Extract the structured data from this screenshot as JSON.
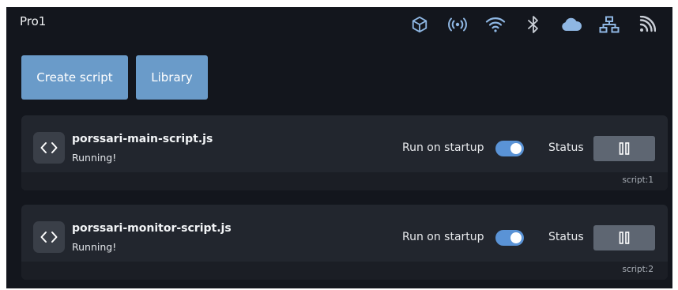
{
  "header": {
    "title": "Pro1",
    "icons": [
      "cube-icon",
      "broadcast-icon",
      "wifi-icon",
      "bluetooth-icon",
      "cloud-icon",
      "network-icon",
      "rss-icon"
    ]
  },
  "actions": {
    "create_label": "Create script",
    "library_label": "Library"
  },
  "scripts": [
    {
      "name": "porssari-main-script.js",
      "status": "Running!",
      "run_on_startup_label": "Run on startup",
      "run_on_startup": true,
      "status_label": "Status",
      "id": "script:1"
    },
    {
      "name": "porssari-monitor-script.js",
      "status": "Running!",
      "run_on_startup_label": "Run on startup",
      "run_on_startup": true,
      "status_label": "Status",
      "id": "script:2"
    }
  ],
  "colors": {
    "background": "#13161d",
    "card": "#22262e",
    "accent_button": "#6a9bc9",
    "toggle_on": "#5a93d6",
    "header_icon": "#8fb7e3"
  }
}
